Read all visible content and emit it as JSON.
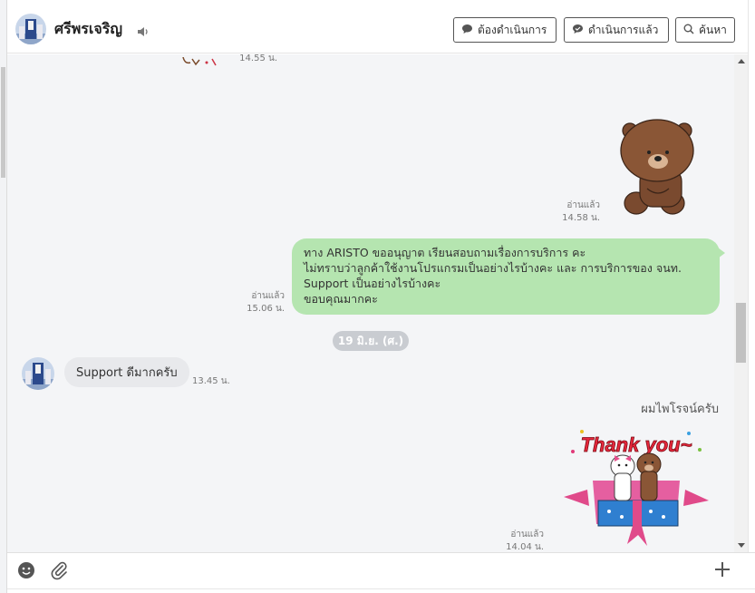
{
  "header": {
    "contact_name": "ศรีพรเจริญ",
    "buttons": {
      "pending": "ต้องดำเนินการ",
      "done": "ดำเนินการแล้ว",
      "search": "ค้นหา"
    }
  },
  "messages": {
    "top_sticker_time": "14.55 น.",
    "bear_sticker": {
      "read_label": "อ่านแล้ว",
      "time": "14.58 น."
    },
    "outgoing_text": {
      "read_label": "อ่านแล้ว",
      "time": "15.06 น.",
      "lines": [
        "ทาง ARISTO ขออนุญาต เรียนสอบถามเรื่องการบริการ คะ",
        "ไม่ทราบว่าลูกค้าใช้งานโปรแกรมเป็นอย่างไรบ้างคะ และ การบริการของ จนท.",
        "Support เป็นอย่างไรบ้างคะ",
        "ขอบคุณมากคะ"
      ]
    },
    "date_separator": "19 มิ.ย. (ศ.)",
    "incoming_text": {
      "text": "Support ดีมากครับ",
      "time": "13.45 น."
    },
    "sticker_caption": "ผมไพโรจน์ครับ",
    "thankyou_sticker": {
      "text": "Thank you~",
      "read_label": "อ่านแล้ว",
      "time": "14.04 น."
    }
  },
  "colors": {
    "outgoing_bubble": "#b5e5b0",
    "incoming_bubble": "#e8e9ec",
    "chat_background": "#f4f5f7",
    "date_pill": "#c9ccd1"
  },
  "icons": [
    "speaker-icon",
    "chat-bubble-icon",
    "search-icon",
    "emoji-icon",
    "paperclip-icon",
    "plus-icon"
  ]
}
